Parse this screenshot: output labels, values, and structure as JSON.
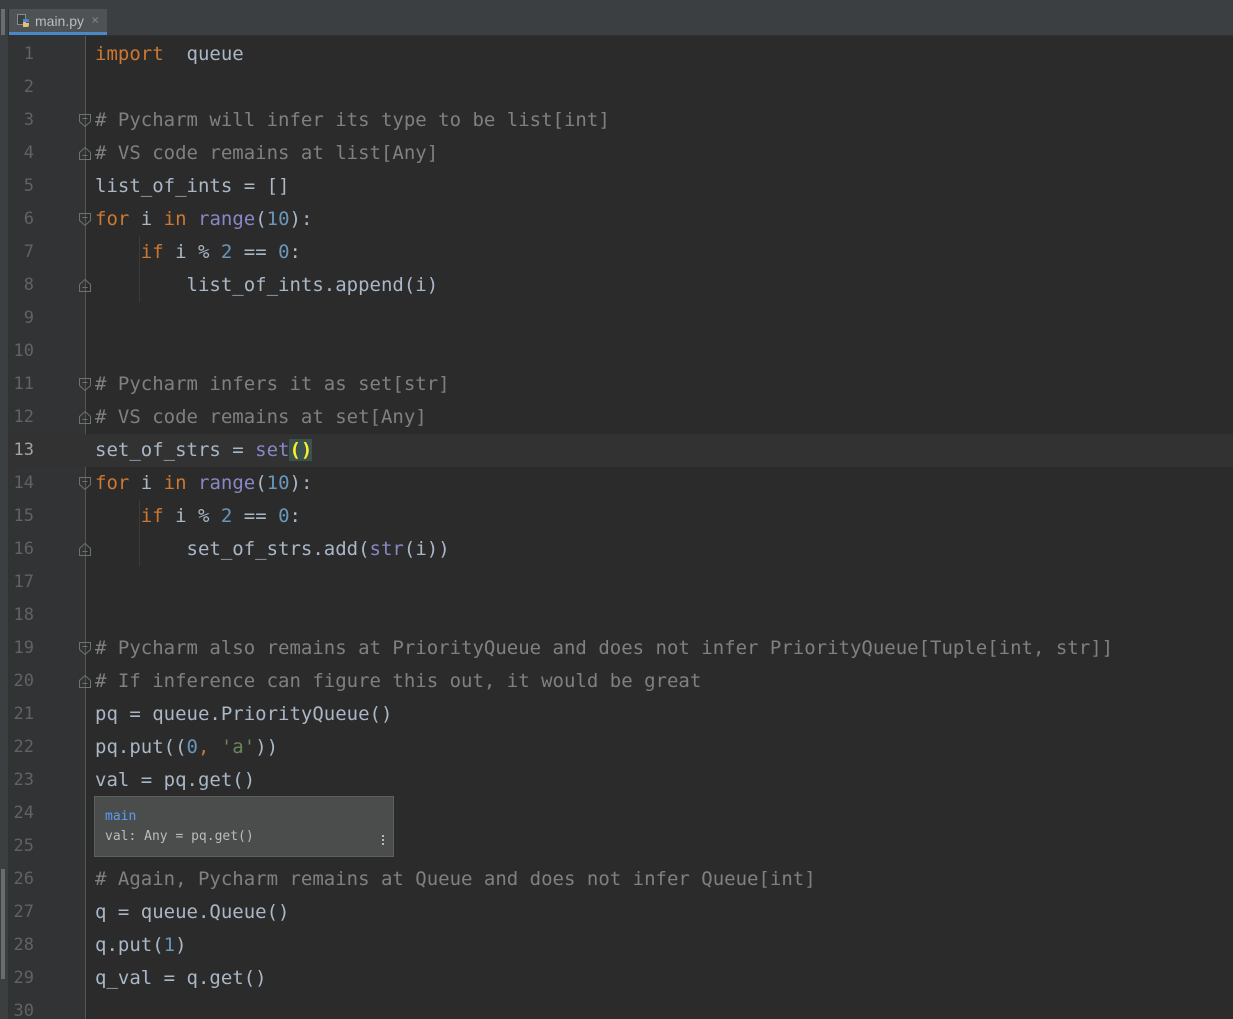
{
  "tabs": [
    {
      "label": "main.py",
      "close_glyph": "×",
      "icon": "python-file-icon",
      "active": true
    }
  ],
  "editor": {
    "current_line": "13",
    "lines": [
      {
        "n": "1",
        "t": [
          [
            "kw",
            "import"
          ],
          [
            "",
            "  queue"
          ]
        ]
      },
      {
        "n": "2",
        "t": []
      },
      {
        "n": "3",
        "t": [
          [
            "cm",
            "# Pycharm will infer its type to be list[int]"
          ]
        ]
      },
      {
        "n": "4",
        "t": [
          [
            "cm",
            "# VS code remains at list[Any]"
          ]
        ]
      },
      {
        "n": "5",
        "t": [
          [
            "",
            "list_of_ints = []"
          ]
        ]
      },
      {
        "n": "6",
        "t": [
          [
            "kw",
            "for"
          ],
          [
            "",
            " i "
          ],
          [
            "kw",
            "in"
          ],
          [
            "",
            " "
          ],
          [
            "bi",
            "range"
          ],
          [
            "",
            "("
          ],
          [
            "num",
            "10"
          ],
          [
            "",
            "):"
          ]
        ]
      },
      {
        "n": "7",
        "t": [
          [
            "",
            "    "
          ],
          [
            "kw",
            "if"
          ],
          [
            "",
            " i % "
          ],
          [
            "num",
            "2"
          ],
          [
            "",
            " == "
          ],
          [
            "num",
            "0"
          ],
          [
            "",
            ":"
          ]
        ]
      },
      {
        "n": "8",
        "t": [
          [
            "",
            "        list_of_ints.append(i)"
          ]
        ]
      },
      {
        "n": "9",
        "t": []
      },
      {
        "n": "10",
        "t": []
      },
      {
        "n": "11",
        "t": [
          [
            "cm",
            "# Pycharm infers it as set[str]"
          ]
        ]
      },
      {
        "n": "12",
        "t": [
          [
            "cm",
            "# VS code remains at set[Any]"
          ]
        ]
      },
      {
        "n": "13",
        "t": [
          [
            "",
            "set_of_strs = "
          ],
          [
            "bi",
            "set"
          ],
          [
            "brace-hl",
            "()"
          ]
        ]
      },
      {
        "n": "14",
        "t": [
          [
            "kw",
            "for"
          ],
          [
            "",
            " i "
          ],
          [
            "kw",
            "in"
          ],
          [
            "",
            " "
          ],
          [
            "bi",
            "range"
          ],
          [
            "",
            "("
          ],
          [
            "num",
            "10"
          ],
          [
            "",
            "):"
          ]
        ]
      },
      {
        "n": "15",
        "t": [
          [
            "",
            "    "
          ],
          [
            "kw",
            "if"
          ],
          [
            "",
            " i % "
          ],
          [
            "num",
            "2"
          ],
          [
            "",
            " == "
          ],
          [
            "num",
            "0"
          ],
          [
            "",
            ":"
          ]
        ]
      },
      {
        "n": "16",
        "t": [
          [
            "",
            "        set_of_strs.add("
          ],
          [
            "bi",
            "str"
          ],
          [
            "",
            "(i))"
          ]
        ]
      },
      {
        "n": "17",
        "t": []
      },
      {
        "n": "18",
        "t": []
      },
      {
        "n": "19",
        "t": [
          [
            "cm",
            "# Pycharm also remains at PriorityQueue and does not infer PriorityQueue[Tuple[int, str]]"
          ]
        ]
      },
      {
        "n": "20",
        "t": [
          [
            "cm",
            "# If inference can figure this out, it would be great"
          ]
        ]
      },
      {
        "n": "21",
        "t": [
          [
            "",
            "pq = queue.PriorityQueue()"
          ]
        ]
      },
      {
        "n": "22",
        "t": [
          [
            "",
            "pq.put(("
          ],
          [
            "num",
            "0"
          ],
          [
            "kw",
            ", "
          ],
          [
            "str",
            "'a'"
          ],
          [
            "",
            "))"
          ]
        ]
      },
      {
        "n": "23",
        "t": [
          [
            "",
            "val = pq.get()"
          ]
        ]
      },
      {
        "n": "24",
        "t": []
      },
      {
        "n": "25",
        "t": []
      },
      {
        "n": "26",
        "t": [
          [
            "cm",
            "# Again, Pycharm remains at Queue and does not infer Queue[int]"
          ]
        ]
      },
      {
        "n": "27",
        "t": [
          [
            "",
            "q = queue.Queue()"
          ]
        ]
      },
      {
        "n": "28",
        "t": [
          [
            "",
            "q.put("
          ],
          [
            "num",
            "1"
          ],
          [
            "",
            ")"
          ]
        ]
      },
      {
        "n": "29",
        "t": [
          [
            "",
            "q_val = q.get()"
          ]
        ]
      },
      {
        "n": "30",
        "t": []
      }
    ],
    "folds": [
      {
        "line": "3",
        "kind": "start"
      },
      {
        "line": "4",
        "kind": "end"
      },
      {
        "line": "6",
        "kind": "start"
      },
      {
        "line": "8",
        "kind": "end"
      },
      {
        "line": "11",
        "kind": "start"
      },
      {
        "line": "12",
        "kind": "end"
      },
      {
        "line": "14",
        "kind": "start"
      },
      {
        "line": "16",
        "kind": "end"
      },
      {
        "line": "19",
        "kind": "start"
      },
      {
        "line": "20",
        "kind": "end"
      }
    ]
  },
  "tooltip": {
    "module": "main",
    "signature": "val: Any = pq.get()",
    "more_icon": "more-vertical-icon"
  },
  "colors": {
    "background": "#2b2b2b",
    "keyword": "#cc7832",
    "comment": "#808080",
    "number": "#6897bb",
    "builtin": "#8888c6",
    "string": "#6a8759",
    "text": "#a9b7c6",
    "line_number": "#606366",
    "tab_underline": "#4a88c7"
  }
}
